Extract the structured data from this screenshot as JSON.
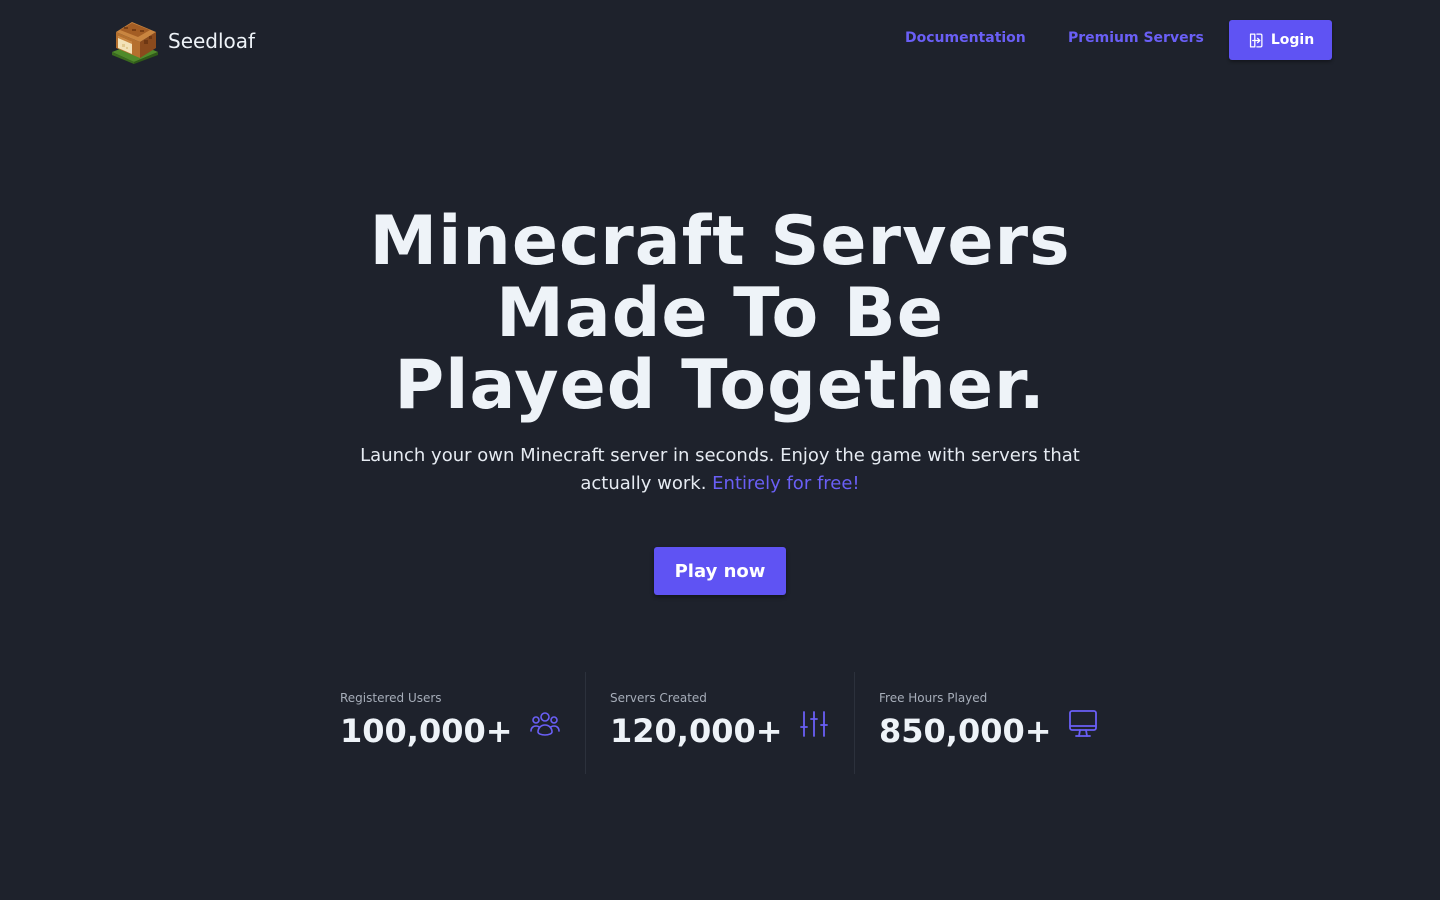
{
  "header": {
    "brand": {
      "name": "Seedloaf",
      "logo_icon": "bread-logo-icon"
    },
    "nav": [
      {
        "label": "Documentation"
      },
      {
        "label": "Premium Servers"
      }
    ],
    "login": {
      "label": "Login",
      "icon": "login-icon"
    }
  },
  "hero": {
    "title_lines": [
      "Minecraft Servers",
      "Made To Be",
      "Played Together."
    ],
    "subtitle": "Launch your own Minecraft server in seconds. Enjoy the game with servers that actually work.",
    "subtitle_accent": "Entirely for free!",
    "cta": "Play now"
  },
  "stats": [
    {
      "label": "Registered Users",
      "value": "100,000+",
      "icon": "users-icon"
    },
    {
      "label": "Servers Created",
      "value": "120,000+",
      "icon": "sliders-icon"
    },
    {
      "label": "Free Hours Played",
      "value": "850,000+",
      "icon": "monitor-icon"
    }
  ],
  "colors": {
    "background": "#1e222c",
    "accent": "#5f53f3",
    "accent_text": "#6a5ff6",
    "text": "#eef3f8",
    "muted": "#a6adb9"
  }
}
